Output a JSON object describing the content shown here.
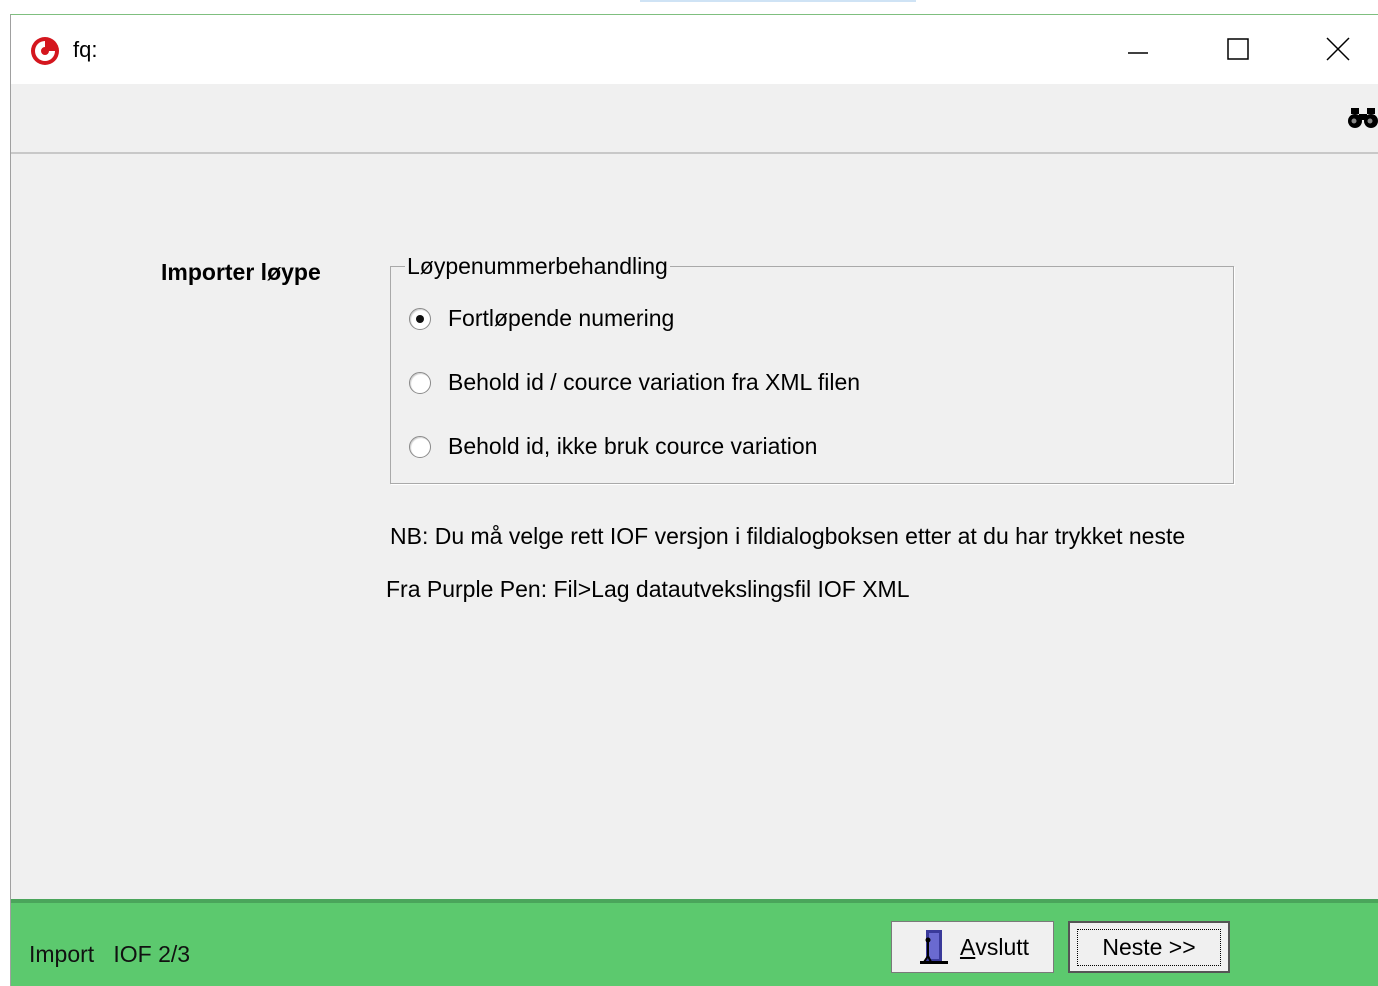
{
  "window": {
    "title": "fq:",
    "controls": {
      "minimize": "—",
      "maximize": "☐",
      "close": "✕"
    }
  },
  "toolbar": {
    "search_icon": "binoculars-icon"
  },
  "main": {
    "section_label": "Importer løype",
    "group": {
      "title": "Løypenummerbehandling",
      "options": [
        {
          "label": "Fortløpende numering",
          "checked": true
        },
        {
          "label": "Behold id / cource variation fra XML filen",
          "checked": false
        },
        {
          "label": "Behold id, ikke bruk cource variation",
          "checked": false
        }
      ]
    },
    "note1": "NB: Du må velge rett IOF versjon i fildialogboksen  etter at du har trykket neste",
    "note2": "Fra Purple Pen: Fil>Lag datautvekslingsfil IOF XML"
  },
  "statusbar": {
    "text": "Import   IOF 2/3",
    "exit_button": {
      "accel": "A",
      "rest": "vslutt"
    },
    "next_button": "Neste >>",
    "color": "#5cc96e"
  }
}
